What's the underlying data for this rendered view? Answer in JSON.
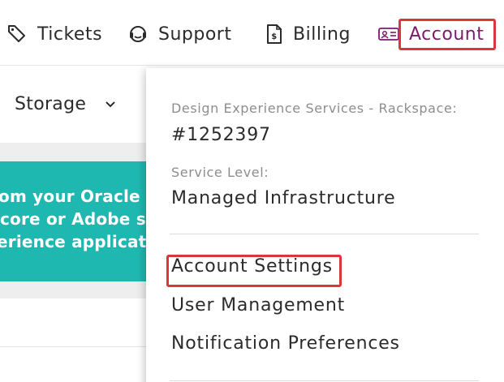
{
  "nav": {
    "tickets_label": "Tickets",
    "support_label": "Support",
    "billing_label": "Billing",
    "account_label": "Account",
    "tickets_icon": "tag-icon",
    "support_icon": "headset-icon",
    "billing_icon": "invoice-icon",
    "account_icon": "id-card-icon"
  },
  "subnav": {
    "storage_label": "Storage"
  },
  "banner": {
    "line1": "om your Oracle CX",
    "line2": "core or Adobe solu",
    "line3": "erience applicatio"
  },
  "account_menu": {
    "account_name_label": "Design Experience Services - Rackspace:",
    "account_number": "#1252397",
    "service_level_label": "Service Level:",
    "service_level_value": "Managed Infrastructure",
    "links": [
      {
        "label": "Account Settings"
      },
      {
        "label": "User Management"
      },
      {
        "label": "Notification Preferences"
      }
    ]
  },
  "colors": {
    "accent": "#7a1c6b",
    "highlight": "#d9363e",
    "banner": "#1fb8b0",
    "text": "#2b2b2b",
    "muted_text": "#8d8d8d"
  }
}
